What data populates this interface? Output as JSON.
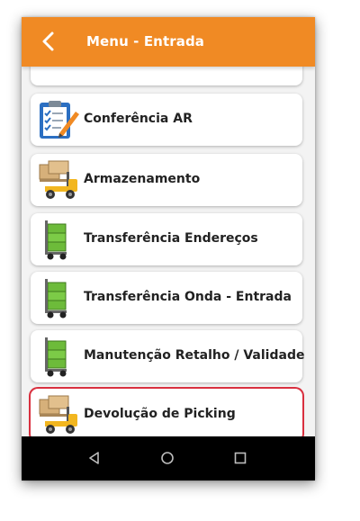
{
  "app_bar": {
    "title": "Menu - Entrada",
    "back_icon": "chevron-left-icon",
    "color": "#f08a24"
  },
  "menu": {
    "items": [
      {
        "label": "",
        "icon": "partial-item"
      },
      {
        "label": "Conferência AR",
        "icon": "clipboard-checklist-icon"
      },
      {
        "label": "Armazenamento",
        "icon": "forklift-boxes-icon"
      },
      {
        "label": "Transferência Endereços",
        "icon": "hand-truck-icon"
      },
      {
        "label": "Transferência Onda - Entrada",
        "icon": "hand-truck-icon"
      },
      {
        "label": "Manutenção Retalho / Validade",
        "icon": "hand-truck-icon"
      },
      {
        "label": "Devolução de Picking",
        "icon": "forklift-boxes-icon",
        "selected": true
      }
    ],
    "selected_border_color": "#d9303f"
  },
  "navigation_bar": {
    "buttons": [
      "back-triangle-icon",
      "home-circle-icon",
      "recents-square-icon"
    ]
  }
}
